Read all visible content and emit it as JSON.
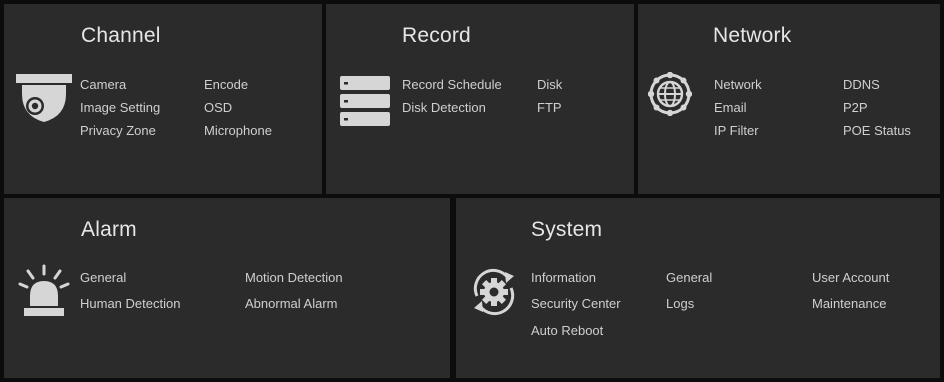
{
  "colors": {
    "background": "#0c0c0c",
    "panel": "#2b2b2b",
    "text": "#cfcfcf",
    "icon": "#d6d6d6"
  },
  "channel": {
    "title": "Channel",
    "icon": "dome-camera-icon",
    "items": [
      "Camera",
      "Encode",
      "Image Setting",
      "OSD",
      "Privacy Zone",
      "Microphone"
    ]
  },
  "record": {
    "title": "Record",
    "icon": "hard-drive-stack-icon",
    "items": [
      "Record Schedule",
      "Disk",
      "Disk Detection",
      "FTP"
    ]
  },
  "network": {
    "title": "Network",
    "icon": "globe-network-icon",
    "items": [
      "Network",
      "DDNS",
      "Email",
      "P2P",
      "IP Filter",
      "POE Status"
    ]
  },
  "alarm": {
    "title": "Alarm",
    "icon": "siren-icon",
    "items": [
      "General",
      "Motion Detection",
      "Human Detection",
      "Abnormal Alarm"
    ]
  },
  "system": {
    "title": "System",
    "icon": "gear-refresh-icon",
    "items": [
      "Information",
      "General",
      "User Account",
      "Security Center",
      "Logs",
      "Maintenance",
      "Auto Reboot"
    ]
  }
}
